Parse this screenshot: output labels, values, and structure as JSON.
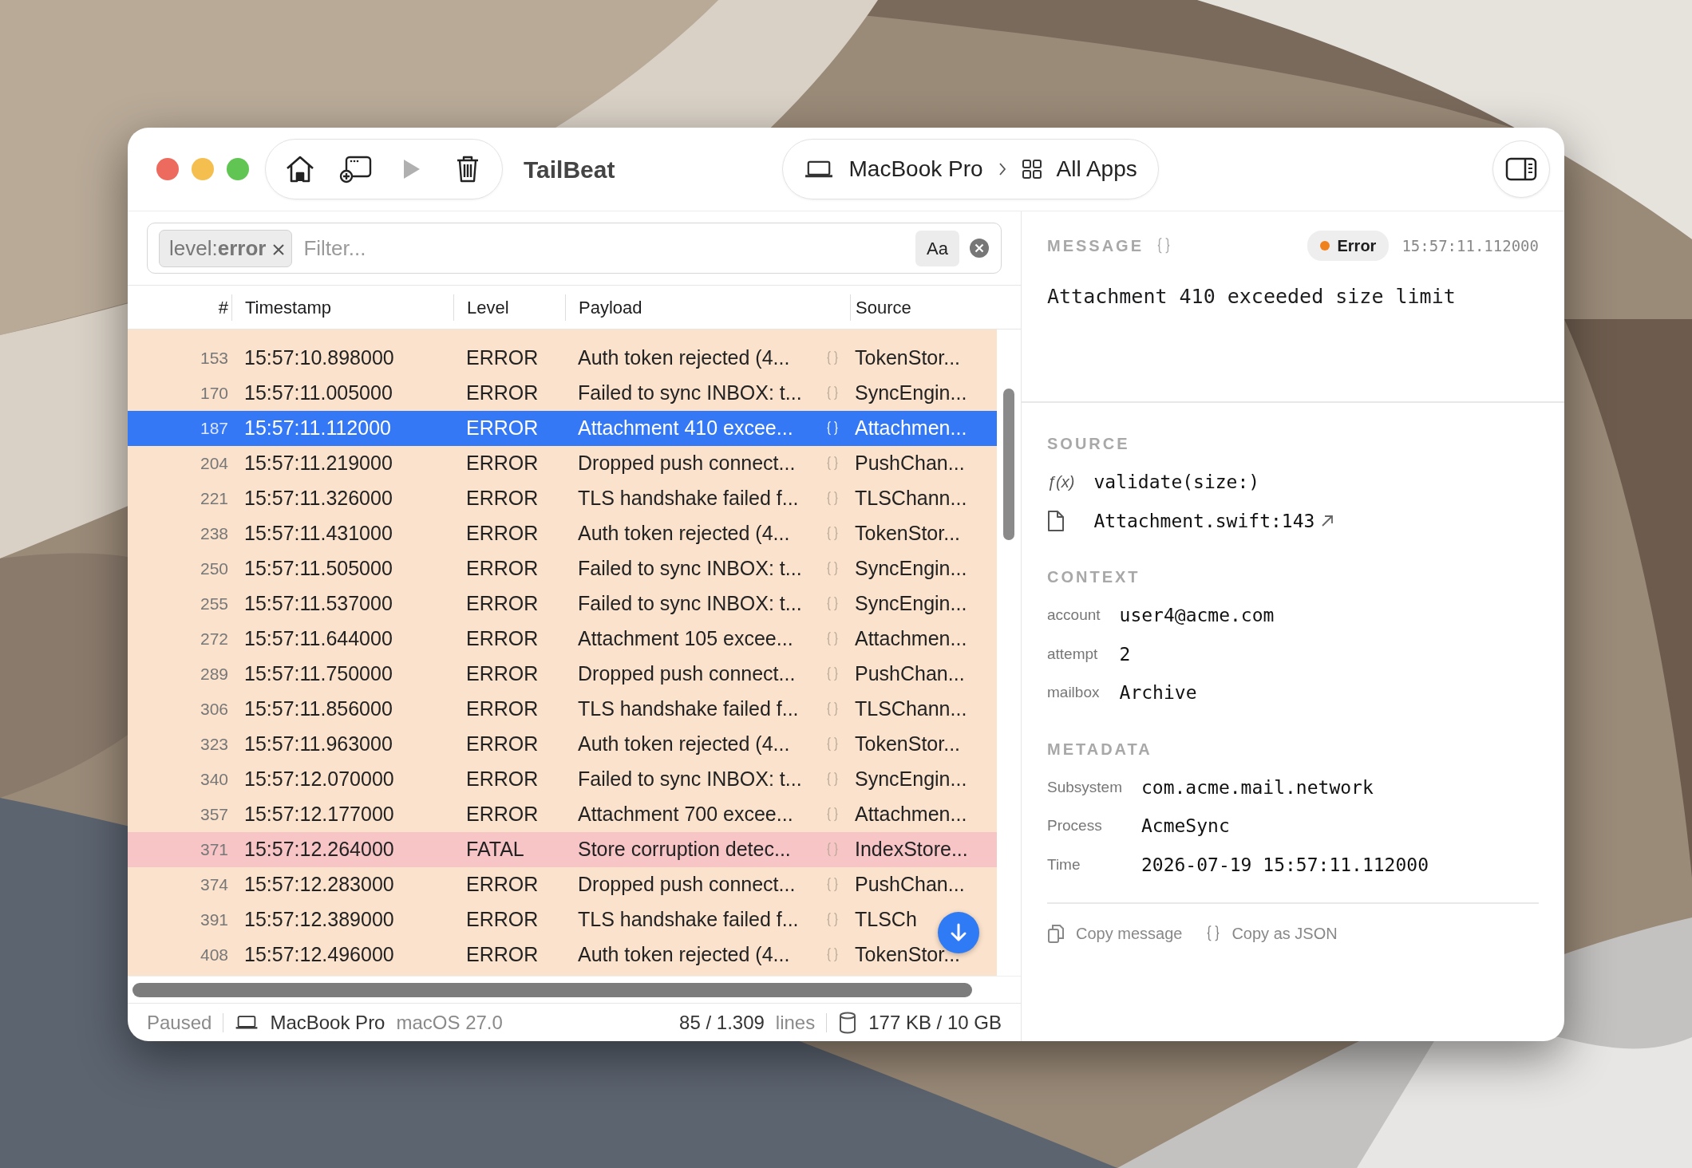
{
  "toolbar": [
    {
      "kind": "home",
      "disabled": false
    },
    {
      "kind": "new-window",
      "disabled": false
    },
    {
      "kind": "play",
      "disabled": true
    },
    {
      "kind": "trash",
      "disabled": false
    }
  ],
  "title": "TailBeat",
  "scope": {
    "device": "MacBook Pro",
    "app": "All Apps"
  },
  "filter": {
    "token": "level:**error**",
    "placeholder": "Filter...",
    "case_button": "Aa"
  },
  "table": {
    "columns": [
      "#",
      "Timestamp",
      "Level",
      "Payload",
      "Source"
    ],
    "rows": [
      {
        "num": "153",
        "timestamp": "15:57:10.898000",
        "level": "ERROR",
        "kind": "error",
        "payload": "Auth token rejected (4...",
        "source": "TokenStor...",
        "selected": false
      },
      {
        "num": "170",
        "timestamp": "15:57:11.005000",
        "level": "ERROR",
        "kind": "error",
        "payload": "Failed to sync INBOX: t...",
        "source": "SyncEngin...",
        "selected": false
      },
      {
        "num": "187",
        "timestamp": "15:57:11.112000",
        "level": "ERROR",
        "kind": "error",
        "payload": "Attachment 410 excee...",
        "source": "Attachmen...",
        "selected": true
      },
      {
        "num": "204",
        "timestamp": "15:57:11.219000",
        "level": "ERROR",
        "kind": "error",
        "payload": "Dropped push connect...",
        "source": "PushChan...",
        "selected": false
      },
      {
        "num": "221",
        "timestamp": "15:57:11.326000",
        "level": "ERROR",
        "kind": "error",
        "payload": "TLS handshake failed f...",
        "source": "TLSChann...",
        "selected": false
      },
      {
        "num": "238",
        "timestamp": "15:57:11.431000",
        "level": "ERROR",
        "kind": "error",
        "payload": "Auth token rejected (4...",
        "source": "TokenStor...",
        "selected": false
      },
      {
        "num": "250",
        "timestamp": "15:57:11.505000",
        "level": "ERROR",
        "kind": "error",
        "payload": "Failed to sync INBOX: t...",
        "source": "SyncEngin...",
        "selected": false
      },
      {
        "num": "255",
        "timestamp": "15:57:11.537000",
        "level": "ERROR",
        "kind": "error",
        "payload": "Failed to sync INBOX: t...",
        "source": "SyncEngin...",
        "selected": false
      },
      {
        "num": "272",
        "timestamp": "15:57:11.644000",
        "level": "ERROR",
        "kind": "error",
        "payload": "Attachment 105 excee...",
        "source": "Attachmen...",
        "selected": false
      },
      {
        "num": "289",
        "timestamp": "15:57:11.750000",
        "level": "ERROR",
        "kind": "error",
        "payload": "Dropped push connect...",
        "source": "PushChan...",
        "selected": false
      },
      {
        "num": "306",
        "timestamp": "15:57:11.856000",
        "level": "ERROR",
        "kind": "error",
        "payload": "TLS handshake failed f...",
        "source": "TLSChann...",
        "selected": false
      },
      {
        "num": "323",
        "timestamp": "15:57:11.963000",
        "level": "ERROR",
        "kind": "error",
        "payload": "Auth token rejected (4...",
        "source": "TokenStor...",
        "selected": false
      },
      {
        "num": "340",
        "timestamp": "15:57:12.070000",
        "level": "ERROR",
        "kind": "error",
        "payload": "Failed to sync INBOX: t...",
        "source": "SyncEngin...",
        "selected": false
      },
      {
        "num": "357",
        "timestamp": "15:57:12.177000",
        "level": "ERROR",
        "kind": "error",
        "payload": "Attachment 700 excee...",
        "source": "Attachmen...",
        "selected": false
      },
      {
        "num": "371",
        "timestamp": "15:57:12.264000",
        "level": "FATAL",
        "kind": "fatal",
        "payload": "Store corruption detec...",
        "source": "IndexStore...",
        "selected": false
      },
      {
        "num": "374",
        "timestamp": "15:57:12.283000",
        "level": "ERROR",
        "kind": "error",
        "payload": "Dropped push connect...",
        "source": "PushChan...",
        "selected": false
      },
      {
        "num": "391",
        "timestamp": "15:57:12.389000",
        "level": "ERROR",
        "kind": "error",
        "payload": "TLS handshake failed f...",
        "source": "TLSCh",
        "selected": false
      },
      {
        "num": "408",
        "timestamp": "15:57:12.496000",
        "level": "ERROR",
        "kind": "error",
        "payload": "Auth token rejected (4...",
        "source": "TokenStor...",
        "selected": false
      }
    ]
  },
  "detail": {
    "label": "MESSAGE",
    "badge": "Error",
    "time": "15:57:11.112000",
    "message": "Attachment 410 exceeded size limit",
    "source": {
      "title": "SOURCE",
      "function_glyph": "ƒ(x)",
      "function": "validate(size:)",
      "file": "Attachment.swift:143"
    },
    "sections": [
      {
        "title": "CONTEXT",
        "items": [
          {
            "key": "account",
            "value": "user4@acme.com"
          },
          {
            "key": "attempt",
            "value": "2"
          },
          {
            "key": "mailbox",
            "value": "Archive"
          }
        ]
      },
      {
        "title": "METADATA",
        "items": [
          {
            "key": "Subsystem",
            "value": "com.acme.mail.network"
          },
          {
            "key": "Process",
            "value": "AcmeSync"
          },
          {
            "key": "Time",
            "value": "2026-07-19 15:57:11.112000"
          }
        ]
      }
    ],
    "actions": [
      {
        "kind": "copy",
        "label": "Copy message"
      },
      {
        "kind": "json",
        "label": "Copy as JSON"
      }
    ]
  },
  "status_bar": {
    "state": "Paused",
    "device": "MacBook Pro",
    "os": "macOS 27.0",
    "count": "85 / 1.309",
    "count_unit": "lines",
    "storage": "177 KB / 10 GB"
  }
}
